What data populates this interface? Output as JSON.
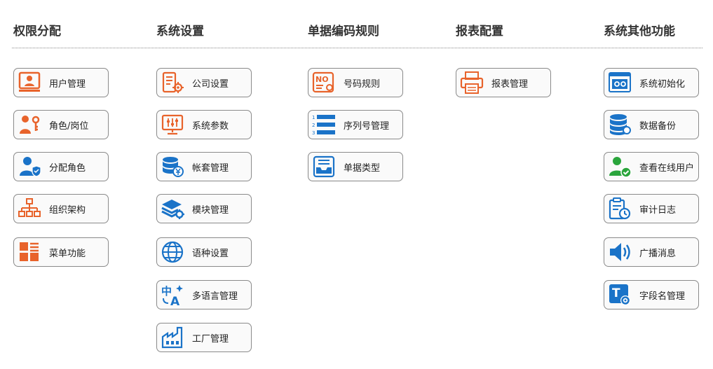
{
  "sections": [
    {
      "title": "权限分配",
      "items": [
        {
          "label": "用户管理",
          "icon": "user-desk-icon"
        },
        {
          "label": "角色/岗位",
          "icon": "role-key-icon"
        },
        {
          "label": "分配角色",
          "icon": "user-shield-icon"
        },
        {
          "label": "组织架构",
          "icon": "org-chart-icon"
        },
        {
          "label": "菜单功能",
          "icon": "menu-grid-icon"
        }
      ]
    },
    {
      "title": "系统设置",
      "items": [
        {
          "label": "公司设置",
          "icon": "company-settings-icon"
        },
        {
          "label": "系统参数",
          "icon": "monitor-sliders-icon"
        },
        {
          "label": "帐套管理",
          "icon": "database-yen-icon"
        },
        {
          "label": "模块管理",
          "icon": "layers-gear-icon"
        },
        {
          "label": "语种设置",
          "icon": "globe-icon"
        },
        {
          "label": "多语言管理",
          "icon": "translate-icon"
        },
        {
          "label": "工厂管理",
          "icon": "factory-icon"
        }
      ]
    },
    {
      "title": "单据编码规则",
      "items": [
        {
          "label": "号码规则",
          "icon": "number-rule-icon"
        },
        {
          "label": "序列号管理",
          "icon": "numbered-list-icon"
        },
        {
          "label": "单据类型",
          "icon": "document-tray-icon"
        }
      ]
    },
    {
      "title": "报表配置",
      "items": [
        {
          "label": "报表管理",
          "icon": "printer-icon"
        }
      ]
    },
    {
      "title": "系统其他功能",
      "items": [
        {
          "label": "系统初始化",
          "icon": "window-gears-icon"
        },
        {
          "label": "数据备份",
          "icon": "database-backup-icon"
        },
        {
          "label": "查看在线用户",
          "icon": "online-user-icon"
        },
        {
          "label": "审计日志",
          "icon": "clipboard-clock-icon"
        },
        {
          "label": "广播消息",
          "icon": "speaker-icon"
        },
        {
          "label": "字段名管理",
          "icon": "text-gear-icon"
        }
      ]
    }
  ],
  "colors": {
    "orange": "#e8632b",
    "blue": "#1a73c8",
    "green": "#2aa53c",
    "border": "#8a8a8a"
  }
}
